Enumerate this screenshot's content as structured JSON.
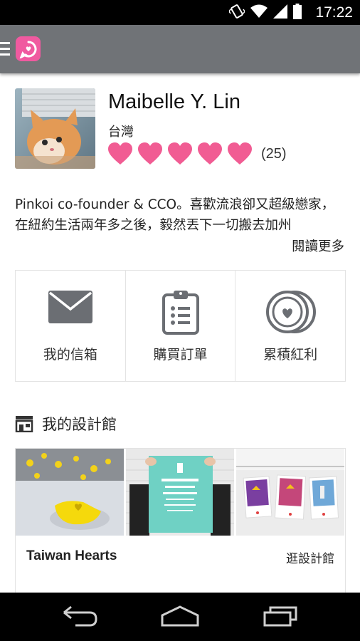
{
  "status_bar": {
    "time": "17:22"
  },
  "app_bar": {
    "logo_icon": "pinkoi-logo-icon",
    "menu_icon": "hamburger-menu-icon",
    "logo_color": "#f05aa0",
    "bar_color": "#707377"
  },
  "profile": {
    "name": "Maibelle Y. Lin",
    "location": "台灣",
    "hearts": 5,
    "rating_count": "(25)",
    "heart_color": "#f15c93",
    "bio_line1": "Pinkoi co-founder & CCO。喜歡流浪卻又超級戀家，",
    "bio_line2": "在紐約生活兩年多之後，毅然丟下一切搬去加州",
    "read_more": "閱讀更多"
  },
  "actions": [
    {
      "label": "我的信箱",
      "icon": "mail-icon"
    },
    {
      "label": "購買訂單",
      "icon": "clipboard-list-icon"
    },
    {
      "label": "累積紅利",
      "icon": "coins-icon"
    }
  ],
  "design_store": {
    "section_title": "我的設計館",
    "section_icon": "storefront-icon",
    "store_name": "Taiwan Hearts",
    "visit_label": "逛設計館"
  }
}
